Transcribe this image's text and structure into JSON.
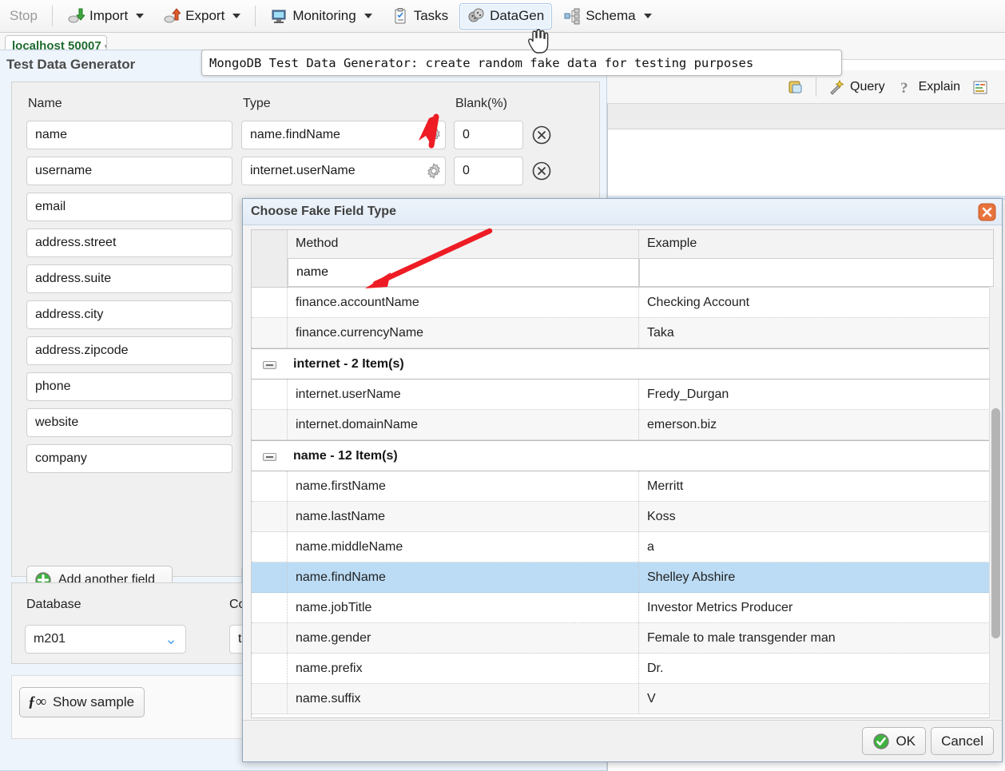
{
  "toolbar": {
    "stop_label": "Stop",
    "import_label": "Import",
    "export_label": "Export",
    "monitoring_label": "Monitoring",
    "tasks_label": "Tasks",
    "datagen_label": "DataGen",
    "schema_label": "Schema"
  },
  "tab": {
    "label": "localhost 50007"
  },
  "tooltip": {
    "text": "MongoDB Test Data Generator: create random fake data for testing purposes"
  },
  "right_toolbar": {
    "query_label": "Query",
    "explain_label": "Explain"
  },
  "panel": {
    "title": "Test Data Generator",
    "headers": {
      "name": "Name",
      "type": "Type",
      "blank": "Blank(%)"
    },
    "fields": [
      {
        "name": "name",
        "type": "name.findName",
        "blank": "0"
      },
      {
        "name": "username",
        "type": "internet.userName",
        "blank": "0"
      },
      {
        "name": "email",
        "type": "",
        "blank": ""
      },
      {
        "name": "address.street",
        "type": "",
        "blank": ""
      },
      {
        "name": "address.suite",
        "type": "",
        "blank": ""
      },
      {
        "name": "address.city",
        "type": "",
        "blank": ""
      },
      {
        "name": "address.zipcode",
        "type": "",
        "blank": ""
      },
      {
        "name": "phone",
        "type": "",
        "blank": ""
      },
      {
        "name": "website",
        "type": "",
        "blank": ""
      },
      {
        "name": "company",
        "type": "",
        "blank": ""
      }
    ],
    "add_field_label": "Add another field",
    "database_label": "Database",
    "collection_label": "Collection",
    "database_value": "m201",
    "collection_value": "tes",
    "show_sample_label": "Show sample"
  },
  "dialog": {
    "title": "Choose Fake Field Type",
    "columns": {
      "method": "Method",
      "example": "Example"
    },
    "filters": {
      "method": "name",
      "example": ""
    },
    "ok_label": "OK",
    "cancel_label": "Cancel",
    "rows": [
      {
        "kind": "item",
        "method": "finance.accountName",
        "example": "Checking Account"
      },
      {
        "kind": "item",
        "method": "finance.currencyName",
        "example": "Taka"
      },
      {
        "kind": "group",
        "label": "internet - 2 Item(s)"
      },
      {
        "kind": "item",
        "method": "internet.userName",
        "example": "Fredy_Durgan"
      },
      {
        "kind": "item",
        "method": "internet.domainName",
        "example": "emerson.biz"
      },
      {
        "kind": "group",
        "label": "name - 12 Item(s)"
      },
      {
        "kind": "item",
        "method": "name.firstName",
        "example": "Merritt"
      },
      {
        "kind": "item",
        "method": "name.lastName",
        "example": "Koss"
      },
      {
        "kind": "item",
        "method": "name.middleName",
        "example": "a"
      },
      {
        "kind": "item",
        "method": "name.findName",
        "example": "Shelley Abshire",
        "selected": true
      },
      {
        "kind": "item",
        "method": "name.jobTitle",
        "example": "Investor Metrics Producer"
      },
      {
        "kind": "item",
        "method": "name.gender",
        "example": "Female to male transgender man"
      },
      {
        "kind": "item",
        "method": "name.prefix",
        "example": "Dr."
      },
      {
        "kind": "item",
        "method": "name.suffix",
        "example": "V"
      }
    ]
  },
  "colors": {
    "accent_blue": "#bcdcf5",
    "panel_blue": "#eef4fb",
    "annotation_red": "#ee1c24",
    "tab_green": "#1f6b2f"
  }
}
